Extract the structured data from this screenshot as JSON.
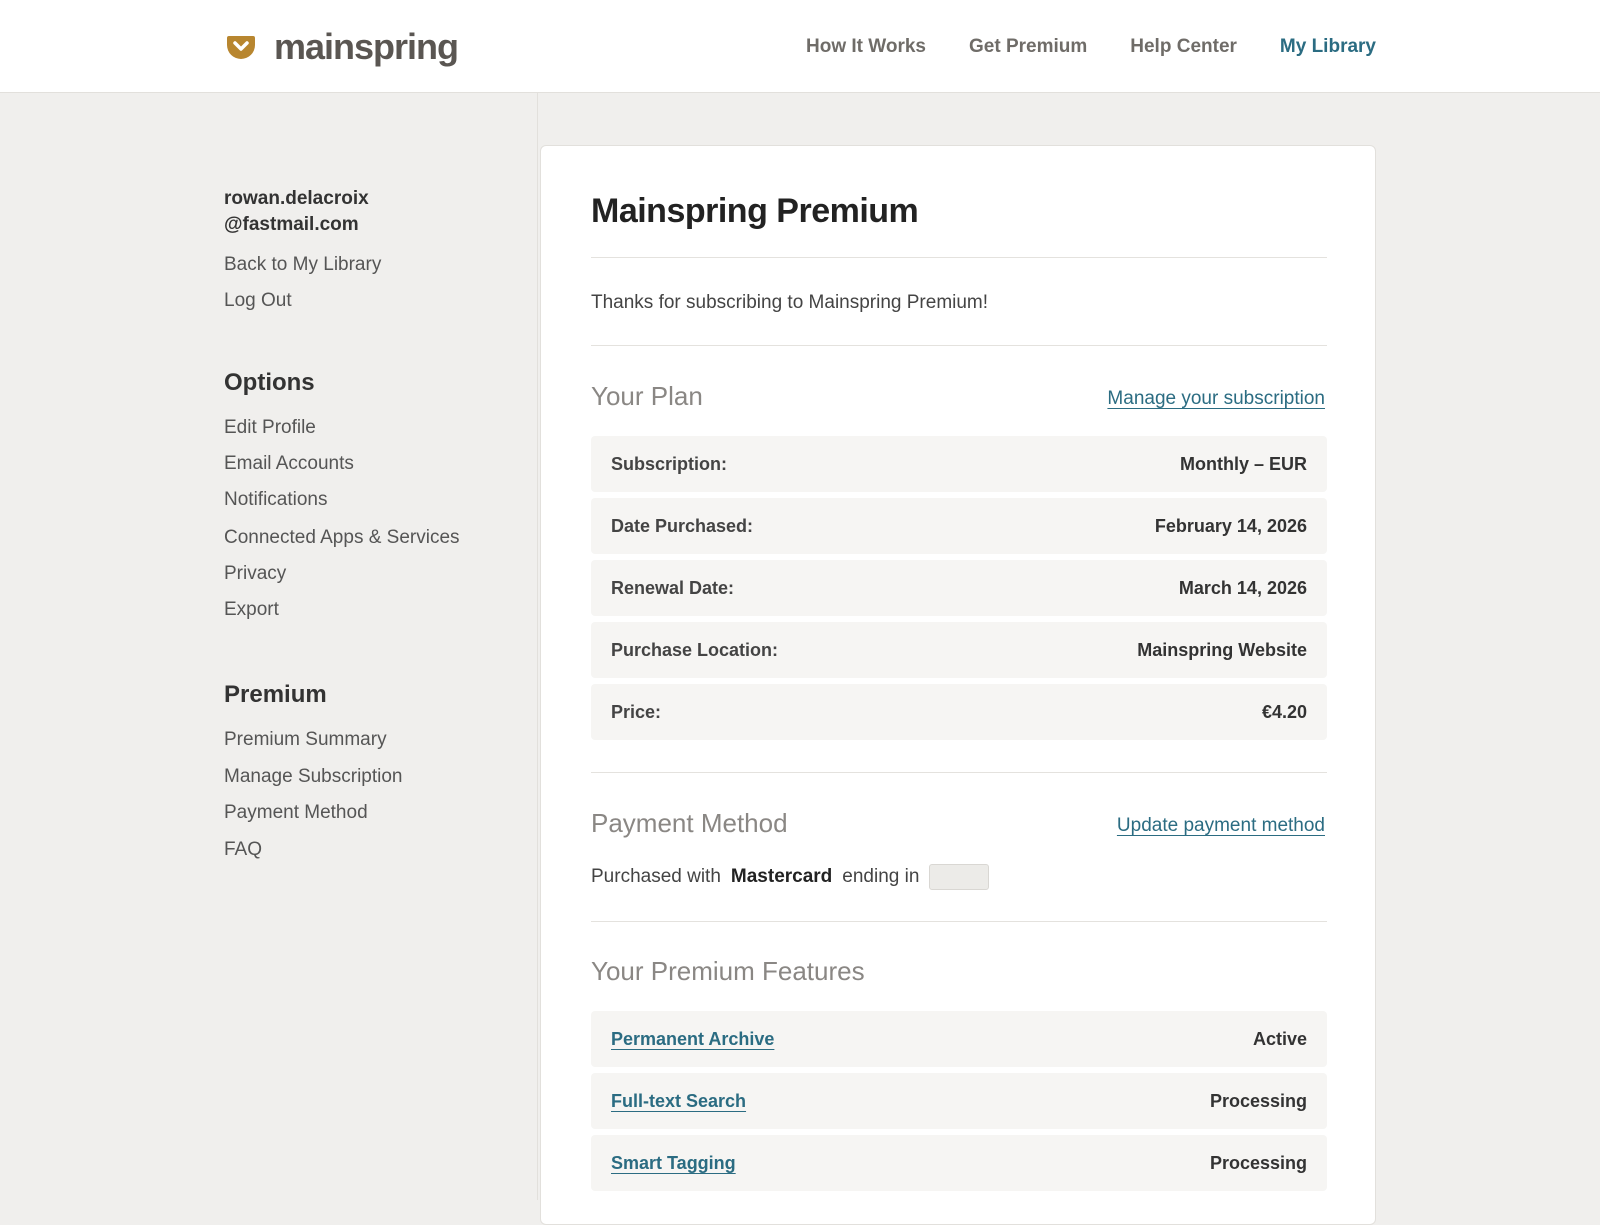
{
  "header": {
    "logo_text": "mainspring",
    "brand_color": "#b8862f",
    "nav": [
      {
        "label": "How It Works"
      },
      {
        "label": "Get Premium"
      },
      {
        "label": "Help Center"
      },
      {
        "label": "My Library",
        "active": true
      }
    ]
  },
  "sidebar": {
    "email_line1": "rowan.delacroix",
    "email_line2": "@fastmail.com",
    "account_links": [
      "Back to My Library",
      "Log Out"
    ],
    "options_heading": "Options",
    "options_links": [
      "Edit Profile",
      "Email Accounts",
      "Notifications",
      "Connected Apps & Services",
      "Privacy",
      "Export"
    ],
    "premium_heading": "Premium",
    "premium_links": [
      "Premium Summary",
      "Manage Subscription",
      "Payment Method",
      "FAQ"
    ]
  },
  "main": {
    "title": "Mainspring Premium",
    "thanks": "Thanks for subscribing to Mainspring Premium!",
    "plan": {
      "title": "Your Plan",
      "link": "Manage your subscription",
      "rows": [
        {
          "label": "Subscription:",
          "value": "Monthly – EUR"
        },
        {
          "label": "Date Purchased:",
          "value": "February 14, 2026"
        },
        {
          "label": "Renewal Date:",
          "value": "March 14, 2026"
        },
        {
          "label": "Purchase Location:",
          "value": "Mainspring Website"
        },
        {
          "label": "Price:",
          "value": "€4.20"
        }
      ]
    },
    "payment": {
      "title": "Payment Method",
      "link": "Update payment method",
      "prefix": "Purchased with",
      "card_brand": "Mastercard",
      "suffix": "ending in"
    },
    "features": {
      "title": "Your Premium Features",
      "rows": [
        {
          "name": "Permanent Archive",
          "status": "Active"
        },
        {
          "name": "Full-text Search",
          "status": "Processing"
        },
        {
          "name": "Smart Tagging",
          "status": "Processing"
        }
      ]
    }
  },
  "colors": {
    "accent": "#2b6c82",
    "background": "#f0efed"
  }
}
